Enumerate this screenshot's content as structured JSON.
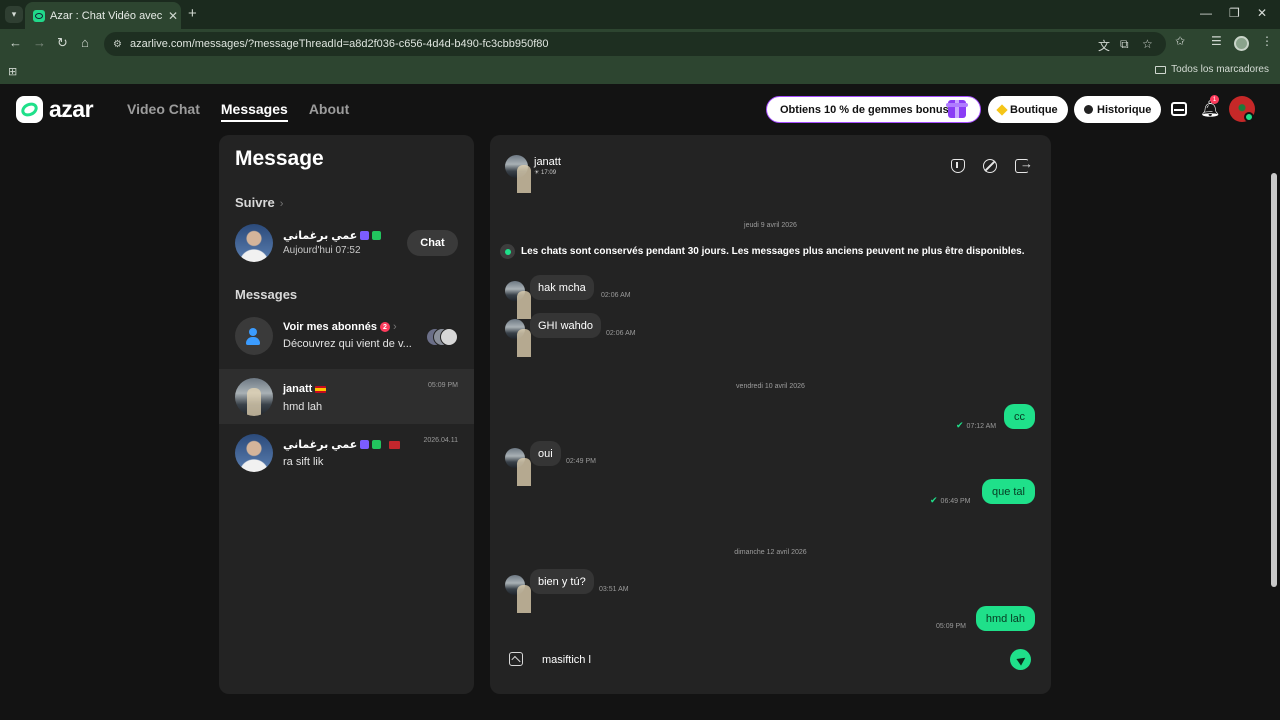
{
  "browser": {
    "tab_title": "Azar : Chat Vidéo avec de nouv",
    "url": "azarlive.com/messages/?messageThreadId=a8d2f036-c656-4d4d-b490-fc3cbb950f80",
    "bookmarks_folder": "Todos los marcadores"
  },
  "site": {
    "logo_text": "azar",
    "nav": [
      "Video Chat",
      "Messages",
      "About"
    ],
    "promo_text": "Obtiens 10 % de gemmes bonus !",
    "boutique_label": "Boutique",
    "historique_label": "Historique",
    "notification_count": "1",
    "accent_color": "#1fe08a"
  },
  "left": {
    "title": "Message",
    "follow_section": "Suivre",
    "follow_user": {
      "name": "عمي برغماني",
      "status": "Aujourd'hui 07:52",
      "chat_button": "Chat"
    },
    "messages_section": "Messages",
    "threads": [
      {
        "name": "Voir mes abonnés",
        "badge": "2",
        "preview": "Découvrez qui vient de v...",
        "time": ""
      },
      {
        "name": "janatt",
        "preview": "hmd lah",
        "time": "05:09 PM"
      },
      {
        "name": "عمي برغماني",
        "preview": "ra sift lik",
        "time": "2026.04.11"
      }
    ]
  },
  "chat": {
    "contact_name": "janatt",
    "contact_status": "17:09",
    "date_1": "jeudi 9 avril 2026",
    "notice": "Les chats sont conservés pendant 30 jours. Les messages plus anciens peuvent ne plus être disponibles.",
    "date_2": "vendredi 10 avril 2026",
    "date_3": "dimanche 12 avril 2026",
    "messages": [
      {
        "dir": "in",
        "text": "hak mcha",
        "time": "02:06 AM"
      },
      {
        "dir": "in",
        "text": "GHI wahdo",
        "time": "02:06 AM"
      },
      {
        "dir": "out",
        "text": "cc",
        "time": "07:12 AM"
      },
      {
        "dir": "in",
        "text": "oui",
        "time": "02:49 PM"
      },
      {
        "dir": "out",
        "text": "que tal",
        "time": "06:49 PM"
      },
      {
        "dir": "in",
        "text": "bien y tú?",
        "time": "03:51 AM"
      },
      {
        "dir": "out",
        "text": "hmd lah",
        "time": "05:09 PM"
      }
    ],
    "composer_value": "masiftich l"
  }
}
